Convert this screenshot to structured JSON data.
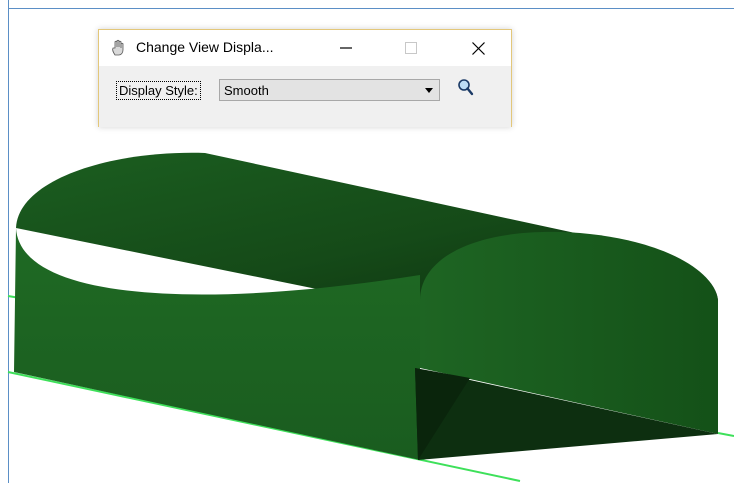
{
  "dialog": {
    "title": "Change View Displa...",
    "display_style_label": "Display Style:",
    "display_style_value": "Smooth",
    "icons": {
      "app": "hand-icon",
      "minimize": "minimize-icon",
      "maximize": "maximize-icon",
      "close": "close-icon",
      "find": "magnifier-icon"
    }
  },
  "colors": {
    "solid_dark": "#0f3a12",
    "solid_mid": "#1b5e20",
    "solid_light": "#2a7a2e",
    "ground_line": "#3ee05a",
    "view_border": "#5b8fc6",
    "dialog_border": "#e3c77a"
  }
}
